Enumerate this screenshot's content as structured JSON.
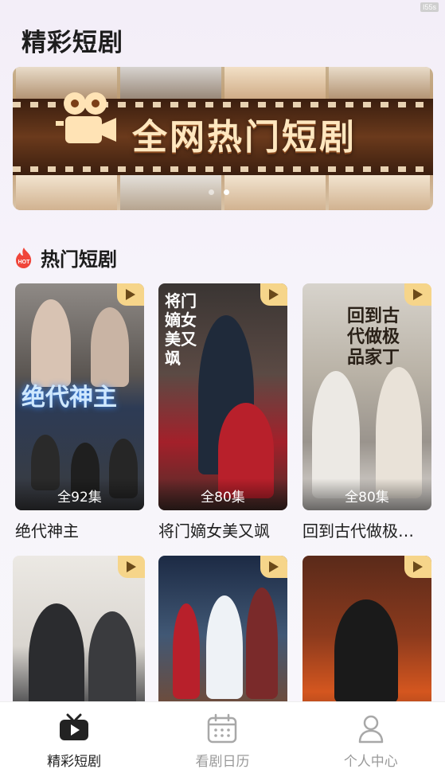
{
  "status": {
    "corner_label": "I55s"
  },
  "app": {
    "title": "精彩短剧"
  },
  "banner": {
    "headline": "全网热门短剧",
    "icon": "movie-camera-icon",
    "dots": [
      {
        "active": false
      },
      {
        "active": true
      }
    ]
  },
  "section": {
    "hot_badge": "HOT",
    "title": "热门短剧"
  },
  "dramas": [
    {
      "title": "绝代神主",
      "episodes": "全92集",
      "poster_text": "绝代神主"
    },
    {
      "title": "将门嫡女美又飒",
      "episodes": "全80集",
      "poster_text": "将门嫡女美又飒"
    },
    {
      "title": "回到古代做极…",
      "episodes": "全80集",
      "poster_text": "回到古代做极品家丁"
    },
    {
      "title": "",
      "episodes": "",
      "poster_text": ""
    },
    {
      "title": "",
      "episodes": "",
      "poster_text": ""
    },
    {
      "title": "",
      "episodes": "",
      "poster_text": ""
    }
  ],
  "tabbar": {
    "items": [
      {
        "label": "精彩短剧",
        "icon": "tv-play-icon",
        "active": true
      },
      {
        "label": "看剧日历",
        "icon": "calendar-icon",
        "active": false
      },
      {
        "label": "个人中心",
        "icon": "user-icon",
        "active": false
      }
    ]
  },
  "colors": {
    "accent": "#f6d58a",
    "hot": "#f0453a"
  }
}
